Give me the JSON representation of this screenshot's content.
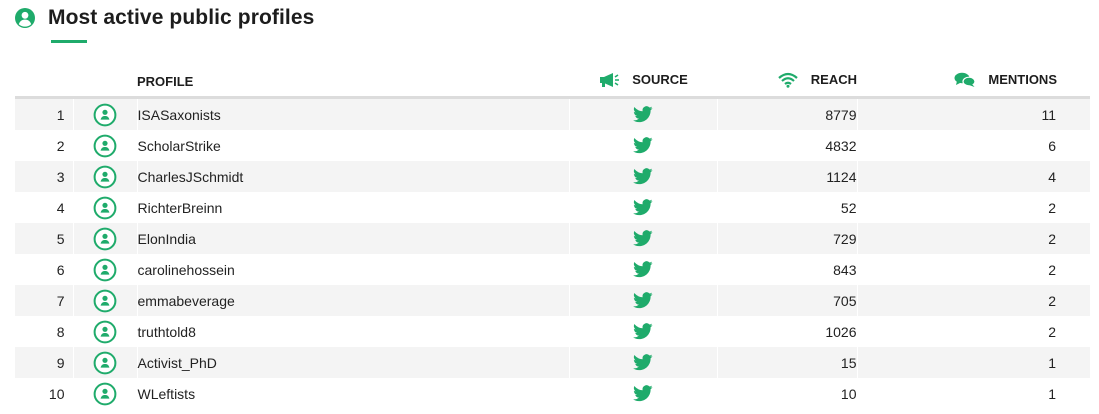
{
  "header": {
    "title": "Most active public profiles",
    "icon": "user-circle-icon"
  },
  "colors": {
    "accent": "#1fab6b",
    "row_stripe": "#f4f4f4",
    "header_rule": "#dcdcdc"
  },
  "table": {
    "columns": {
      "profile": "PROFILE",
      "source": "SOURCE",
      "reach": "REACH",
      "mentions": "MENTIONS"
    },
    "column_icons": {
      "source": "megaphone-icon",
      "reach": "wifi-icon",
      "mentions": "chat-bubbles-icon"
    },
    "rows": [
      {
        "rank": "1",
        "profile": "ISASaxonists",
        "source": "twitter-icon",
        "reach": "8779",
        "mentions": "11"
      },
      {
        "rank": "2",
        "profile": "ScholarStrike",
        "source": "twitter-icon",
        "reach": "4832",
        "mentions": "6"
      },
      {
        "rank": "3",
        "profile": "CharlesJSchmidt",
        "source": "twitter-icon",
        "reach": "1124",
        "mentions": "4"
      },
      {
        "rank": "4",
        "profile": "RichterBreinn",
        "source": "twitter-icon",
        "reach": "52",
        "mentions": "2"
      },
      {
        "rank": "5",
        "profile": "ElonIndia",
        "source": "twitter-icon",
        "reach": "729",
        "mentions": "2"
      },
      {
        "rank": "6",
        "profile": "carolinehossein",
        "source": "twitter-icon",
        "reach": "843",
        "mentions": "2"
      },
      {
        "rank": "7",
        "profile": "emmabeverage",
        "source": "twitter-icon",
        "reach": "705",
        "mentions": "2"
      },
      {
        "rank": "8",
        "profile": "truthtold8",
        "source": "twitter-icon",
        "reach": "1026",
        "mentions": "2"
      },
      {
        "rank": "9",
        "profile": "Activist_PhD",
        "source": "twitter-icon",
        "reach": "15",
        "mentions": "1"
      },
      {
        "rank": "10",
        "profile": "WLeftists",
        "source": "twitter-icon",
        "reach": "10",
        "mentions": "1"
      }
    ]
  }
}
